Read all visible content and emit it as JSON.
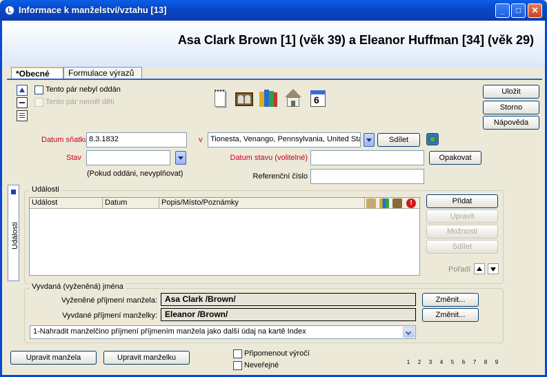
{
  "window": {
    "title": "Informace k manželství/vztahu [13]"
  },
  "header": {
    "names": "Asa Clark Brown [1] (věk 39) a Eleanor Huffman [34] (věk 29)"
  },
  "tabs": [
    {
      "label": "*Obecné"
    },
    {
      "label": "Formulace výrazů"
    }
  ],
  "options": {
    "not_married": "Tento pár nebyl oddán",
    "no_children": "Tento pár neměl děti"
  },
  "form": {
    "marriage_date_label": "Datum sňatku",
    "marriage_date_value": "8.3.1832",
    "in_label": "v",
    "place_value": "Tionesta, Venango, Pennsylvania, United Sta",
    "share_label": "Sdílet",
    "status_label": "Stav",
    "status_value": "",
    "status_hint": "(Pokud oddáni, nevyplňovat)",
    "status_date_label": "Datum stavu (volitelné)",
    "status_date_value": "",
    "repeat_label": "Opakovat",
    "ref_label": "Referenční číslo",
    "ref_value": ""
  },
  "buttons": {
    "save": "Uložit",
    "cancel": "Storno",
    "help": "Nápověda"
  },
  "events": {
    "legend": "Události",
    "side_tab": "Události",
    "columns": [
      "Událost",
      "Datum",
      "Popis/Místo/Poznámky"
    ],
    "add": "Přidat",
    "edit": "Upravit",
    "options": "Možnosti",
    "share": "Sdílet",
    "order": "Pořadí"
  },
  "names": {
    "legend": "Vyvdaná (vyženěná) jména",
    "husband_label": "Vyženěné příjmení manžela:",
    "husband_value": "Asa Clark /Brown/",
    "wife_label": "Vyvdané příjmení manželky:",
    "wife_value": "Eleanor /Brown/",
    "change_label": "Změnit...",
    "option_selected": "1-Nahradit manželčino příjmení příjmením manžela jako další údaj na kartě Index"
  },
  "bottom": {
    "edit_husband": "Upravit manžela",
    "edit_wife": "Upravit manželku",
    "remind": "Připomenout výročí",
    "private": "Neveřejné",
    "pages": [
      "1",
      "2",
      "3",
      "4",
      "5",
      "6",
      "7",
      "8",
      "9"
    ]
  }
}
